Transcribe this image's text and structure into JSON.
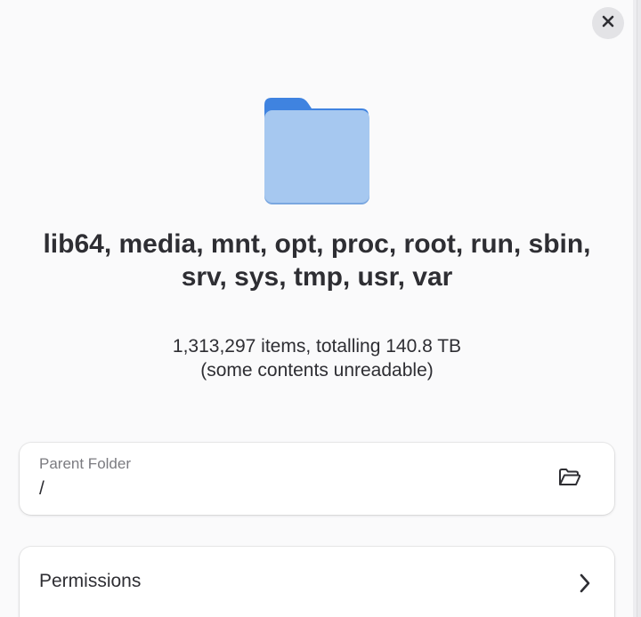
{
  "dialog": {
    "close_icon": "close-icon",
    "folder_icon": "folder-icon",
    "title_line1": "lib64, media, mnt, opt, proc, root, run, sbin,",
    "title_line2": "srv, sys, tmp, usr, var",
    "summary_line1": "1,313,297 items, totalling 140.8 TB",
    "summary_line2": "(some contents unreadable)"
  },
  "parent_folder": {
    "label": "Parent Folder",
    "value": "/",
    "open_icon": "open-folder-icon"
  },
  "permissions": {
    "label": "Permissions",
    "chevron_icon": "chevron-right-icon"
  },
  "colors": {
    "folder_tab": "#3f83e0",
    "folder_body": "#a6c8f0",
    "text": "#2e2e33",
    "secondary_text": "#7b7b80"
  }
}
